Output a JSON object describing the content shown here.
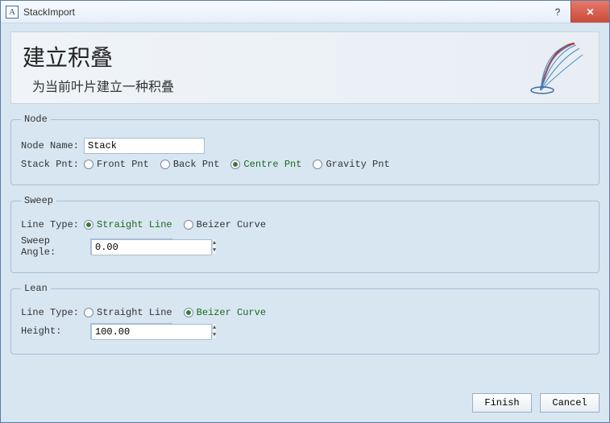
{
  "window": {
    "title": "StackImport",
    "help_symbol": "?",
    "close_symbol": "✕"
  },
  "header": {
    "title": "建立积叠",
    "subtitle": "为当前叶片建立一种积叠"
  },
  "groups": {
    "node": {
      "legend": "Node",
      "name_label": "Node Name:",
      "name_value": "Stack",
      "stack_label": "Stack Pnt:",
      "options": {
        "front": "Front Pnt",
        "back": "Back Pnt",
        "centre": "Centre Pnt",
        "gravity": "Gravity Pnt"
      },
      "selected": "centre"
    },
    "sweep": {
      "legend": "Sweep",
      "line_label": "Line Type:",
      "options": {
        "straight": "Straight Line",
        "beizer": "Beizer Curve"
      },
      "selected": "straight",
      "angle_label": "Sweep Angle:",
      "angle_value": "0.00"
    },
    "lean": {
      "legend": "Lean",
      "line_label": "Line Type:",
      "options": {
        "straight": "Straight Line",
        "beizer": "Beizer Curve"
      },
      "selected": "beizer",
      "height_label": "Height:",
      "height_value": "100.00"
    }
  },
  "footer": {
    "finish": "Finish",
    "cancel": "Cancel"
  }
}
